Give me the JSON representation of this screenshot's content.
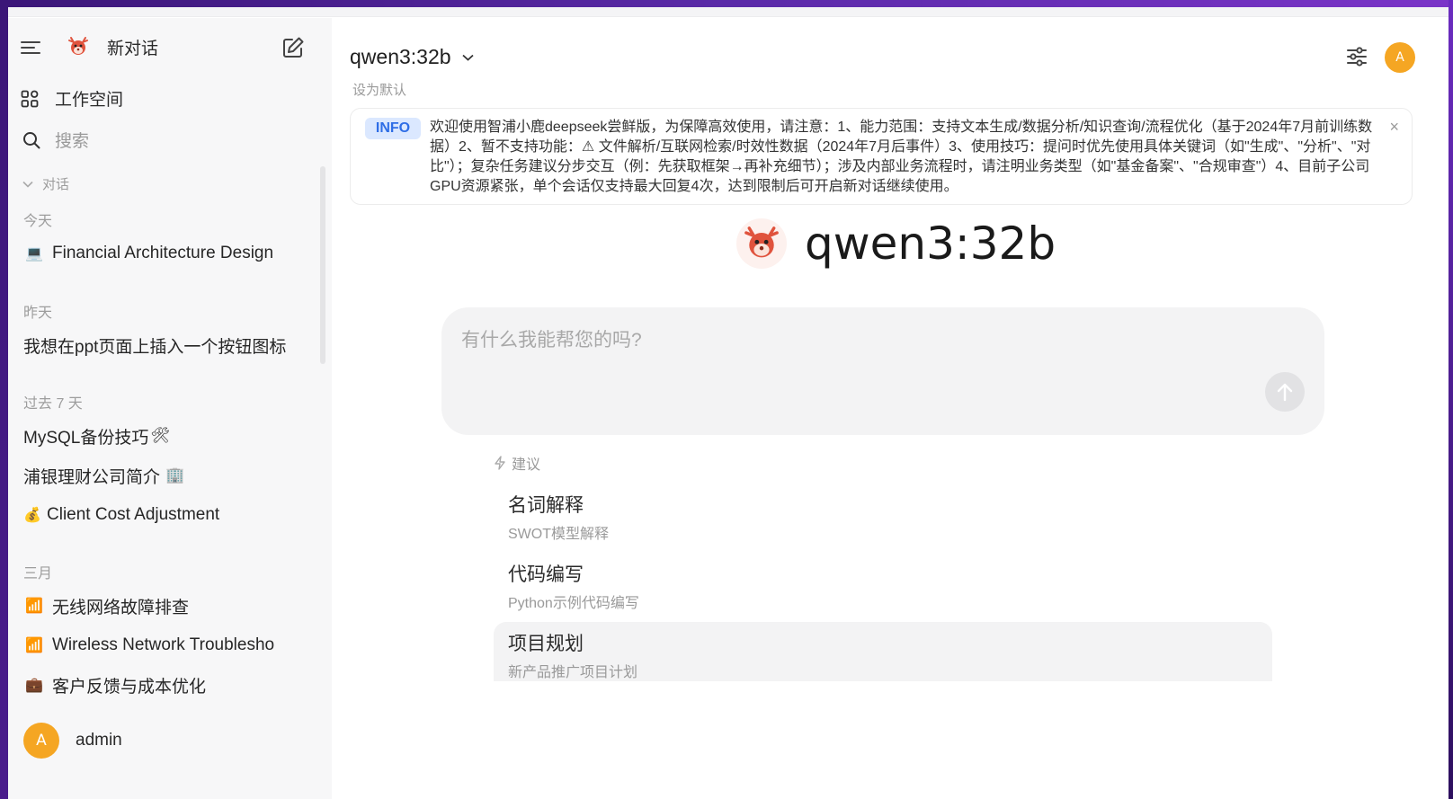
{
  "sidebar": {
    "new_chat": "新对话",
    "workspace": "工作空间",
    "search": "搜索",
    "section_label": "对话",
    "groups": [
      {
        "title": "今天",
        "items": [
          {
            "emoji": "💻",
            "label": "Financial Architecture Design"
          }
        ]
      },
      {
        "title": "昨天",
        "items": [
          {
            "emoji": "",
            "label": "我想在ppt页面上插入一个按钮图标"
          }
        ]
      },
      {
        "title": "过去 7 天",
        "items": [
          {
            "emoji": "",
            "label": "MySQL备份技巧",
            "suffix": "🛠"
          },
          {
            "emoji": "",
            "label": "浦银理财公司简介",
            "suffix": "🏢"
          },
          {
            "emoji": "💰",
            "label": "Client Cost Adjustment"
          }
        ]
      },
      {
        "title": "三月",
        "items": [
          {
            "emoji": "📶",
            "label": "无线网络故障排查"
          },
          {
            "emoji": "📶",
            "label": "Wireless Network Troublesho"
          },
          {
            "emoji": "💼",
            "label": "客户反馈与成本优化"
          }
        ]
      }
    ],
    "user": {
      "initial": "A",
      "name": "admin"
    }
  },
  "header": {
    "model": "qwen3:32b",
    "set_default": "设为默认",
    "avatar_initial": "A"
  },
  "banner": {
    "badge": "INFO",
    "text": "欢迎使用智浦小鹿deepseek尝鲜版，为保障高效使用，请注意：1、能力范围：支持文本生成/数据分析/知识查询/流程优化（基于2024年7月前训练数据）2、暂不支持功能：⚠ 文件解析/互联网检索/时效性数据（2024年7月后事件）3、使用技巧：提问时优先使用具体关键词（如\"生成\"、\"分析\"、\"对比\"）；复杂任务建议分步交互（例：先获取框架→再补充细节）；涉及内部业务流程时，请注明业务类型（如\"基金备案\"、\"合规审查\"）4、目前子公司GPU资源紧张，单个会话仅支持最大回复4次，达到限制后可开启新对话继续使用。",
    "close": "×"
  },
  "hero": {
    "title": "qwen3:32b"
  },
  "input": {
    "placeholder": "有什么我能帮您的吗?"
  },
  "suggestions": {
    "heading": "建议",
    "items": [
      {
        "title": "名词解释",
        "subtitle": "SWOT模型解释"
      },
      {
        "title": "代码编写",
        "subtitle": "Python示例代码编写"
      },
      {
        "title": "项目规划",
        "subtitle": "新产品推广项目计划"
      }
    ]
  },
  "colors": {
    "accent_avatar": "#f5a623",
    "badge_bg": "#dbe8ff",
    "badge_text": "#2f6ee6"
  }
}
